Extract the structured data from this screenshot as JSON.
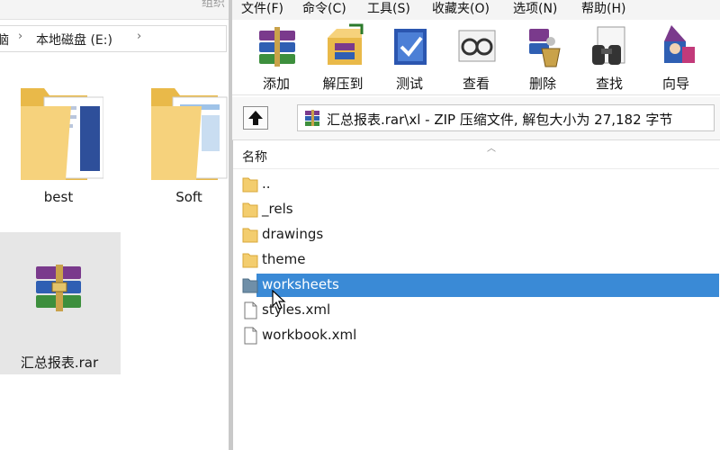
{
  "explorer": {
    "top_label": "组织",
    "breadcrumb": {
      "prefix": "脑",
      "sep": "›",
      "drive": "本地磁盘 (E:)",
      "arrow_sep": "›"
    },
    "items": [
      {
        "label": "best",
        "icon": "folder-icon"
      },
      {
        "label": "Soft",
        "icon": "folder-icon"
      },
      {
        "label": "汇总报表.rar",
        "icon": "winrar-archive-icon",
        "selected": true
      }
    ]
  },
  "winrar": {
    "menu": [
      "文件(F)",
      "命令(C)",
      "工具(S)",
      "收藏夹(O)",
      "选项(N)",
      "帮助(H)"
    ],
    "toolbar": [
      {
        "label": "添加",
        "icon": "add-archive-icon"
      },
      {
        "label": "解压到",
        "icon": "extract-to-icon"
      },
      {
        "label": "测试",
        "icon": "test-icon"
      },
      {
        "label": "查看",
        "icon": "view-icon"
      },
      {
        "label": "删除",
        "icon": "delete-icon"
      },
      {
        "label": "查找",
        "icon": "find-icon"
      },
      {
        "label": "向导",
        "icon": "wizard-icon"
      }
    ],
    "path": "汇总报表.rar\\xl - ZIP 压缩文件, 解包大小为 27,182 字节",
    "column_name": "名称",
    "files": [
      {
        "name": "..",
        "type": "folder"
      },
      {
        "name": "_rels",
        "type": "folder"
      },
      {
        "name": "drawings",
        "type": "folder"
      },
      {
        "name": "theme",
        "type": "folder"
      },
      {
        "name": "worksheets",
        "type": "folder",
        "selected": true
      },
      {
        "name": "styles.xml",
        "type": "file"
      },
      {
        "name": "workbook.xml",
        "type": "file"
      }
    ]
  },
  "colors": {
    "selection": "#3a8ad6",
    "folder": "#f3cd6e"
  }
}
